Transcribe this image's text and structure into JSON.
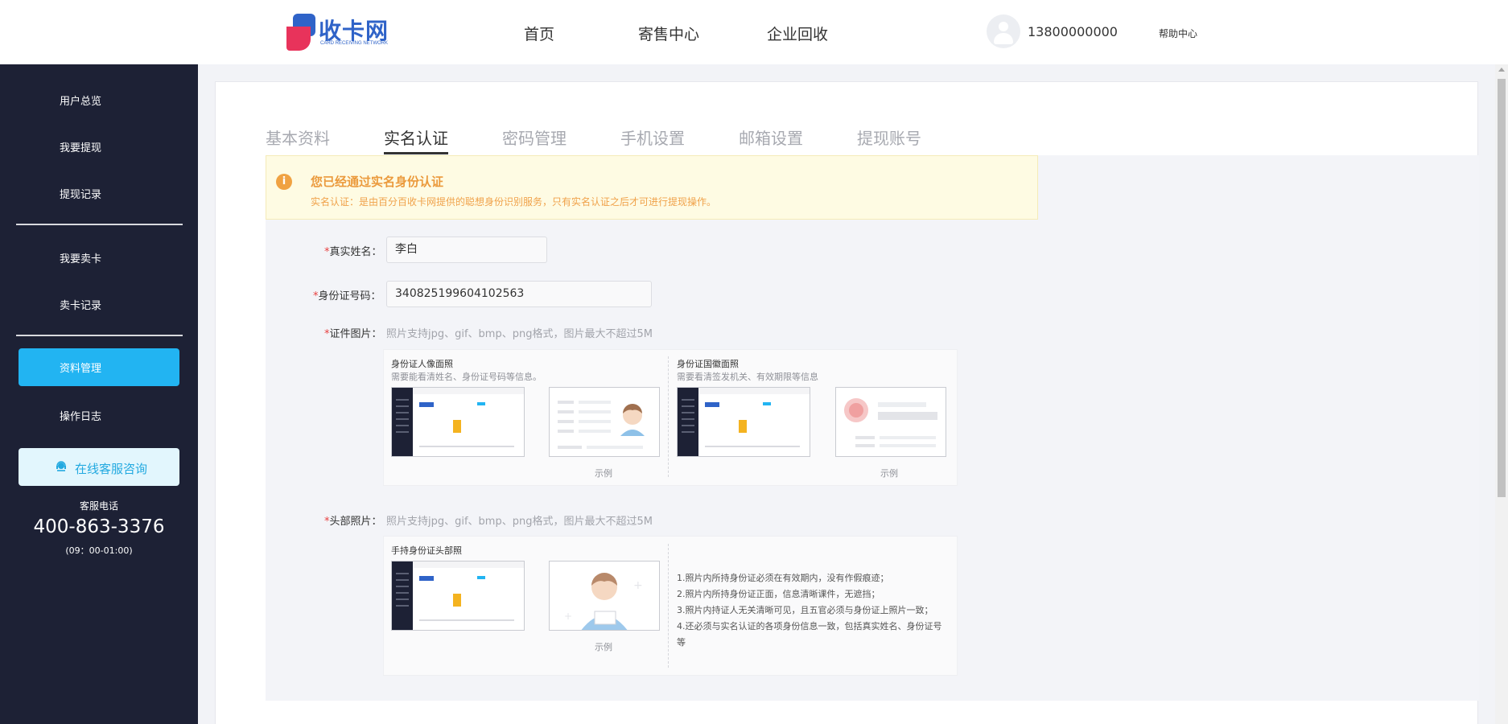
{
  "header": {
    "logo_text": "收卡网",
    "logo_sub": "CARD RECEIVING NETWORK",
    "nav": [
      "首页",
      "寄售中心",
      "企业回收"
    ],
    "user_phone": "13800000000",
    "help": "帮助中心"
  },
  "sidebar": {
    "items": [
      "用户总览",
      "我要提现",
      "提现记录",
      "我要卖卡",
      "卖卡记录",
      "资料管理",
      "操作日志"
    ],
    "active": "资料管理",
    "consult_label": "在线客服咨询",
    "service_label": "客服电话",
    "service_phone": "400-863-3376",
    "service_hours": "(09：00-01:00)"
  },
  "tabs": [
    "基本资料",
    "实名认证",
    "密码管理",
    "手机设置",
    "邮箱设置",
    "提现账号"
  ],
  "active_tab": "实名认证",
  "notice": {
    "icon": "i",
    "title": "您已经通过实名身份认证",
    "desc": "实名认证：是由百分百收卡网提供的聪想身份识别服务，只有实名认证之后才可进行提现操作。"
  },
  "form": {
    "required_mark": "*",
    "name_label": "真实姓名：",
    "name_value": "李白",
    "id_label": "身份证号码：",
    "id_value": "340825199604102563",
    "cert_label": "证件图片：",
    "cert_hint": "照片支持jpg、gif、bmp、png格式，图片最大不超过5M",
    "front_title": "身份证人像面照",
    "front_sub": "需要能看清姓名、身份证号码等信息。",
    "back_title": "身份证国徽面照",
    "back_sub": "需要看清签发机关、有效期限等信息",
    "example": "示例",
    "head_label": "头部照片：",
    "head_hint": "照片支持jpg、gif、bmp、png格式，图片最大不超过5M",
    "hold_title": "手持身份证头部照",
    "rules": [
      "1.照片内所持身份证必须在有效期内，没有作假痕迹；",
      "2.照片内所持身份证正面，信息清晰课件，无遮挡；",
      "3.照片内持证人无关清晰可见，且五官必须与身份证上照片一致；",
      "4.还必须与实名认证的各项身份信息一致，包括真实姓名、身份证号等"
    ]
  },
  "colors": {
    "sidebar_bg": "#1d2135",
    "accent": "#22b4f2",
    "notice_bg": "#fefbe3",
    "notice_text": "#eb9a3c",
    "required": "#e84040"
  }
}
